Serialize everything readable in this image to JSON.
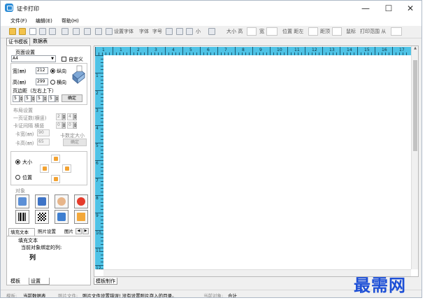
{
  "window": {
    "title": "证卡打印"
  },
  "menu": [
    "文件(F)",
    "编辑(E)",
    "帮助(H)"
  ],
  "toolbar": {
    "set_font": "设置字体",
    "font": "字体",
    "font_size": "字号",
    "size_small": "小",
    "size_label": "大小 高",
    "width_label": "宽",
    "position_label": "位置 距左",
    "top_label": "距顶",
    "border_label": "鼠标",
    "print_range": "打印范围 从"
  },
  "top_tabs": [
    "证书模板",
    "数据表"
  ],
  "page_settings": {
    "title": "页面设置",
    "paper": "A4",
    "custom": "自定义",
    "width_label": "宽(㎜)",
    "width_value": "212",
    "height_label": "高(㎜)",
    "height_value": "299",
    "portrait": "纵向",
    "landscape": "横向",
    "margin_label": "页边距（左右上下）",
    "margins": [
      "5",
      "5",
      "5",
      "5"
    ],
    "ok": "确定"
  },
  "layout_settings": {
    "title": "布局设置",
    "per_page": "一页证数(横竖)",
    "per_page_values": [
      "2",
      "4"
    ],
    "gap": "卡证间隔 横竖",
    "gap_values": [
      "0",
      "0"
    ],
    "card_width": "卡宽(㎜)",
    "card_width_value": "90",
    "card_height": "卡高(㎜)",
    "card_height_value": "65",
    "fixed_size": "卡数定大小",
    "ok": "确定"
  },
  "move_panel": {
    "size": "大小",
    "position": "位置"
  },
  "objects": {
    "title": "对象"
  },
  "sub_tabs": [
    "填充文本",
    "照片设置",
    "图片"
  ],
  "fill_text": {
    "title": "填充文本",
    "bound_column_label": "当前对象绑定的列:",
    "column": "列"
  },
  "bottom_tabs_left": [
    "模板",
    "设置"
  ],
  "bottom_tabs_right": [
    "模板制作"
  ],
  "ruler": {
    "h_labels": [
      "1",
      "1",
      "2",
      "3",
      "4",
      "5",
      "6",
      "7",
      "8",
      "9",
      "10",
      "11",
      "12",
      "13",
      "14",
      "15",
      "16",
      "17"
    ],
    "v_labels": [
      "1",
      "2",
      "3",
      "4",
      "5",
      "6",
      "7",
      "8",
      "9",
      "10",
      "11",
      "12"
    ]
  },
  "status": {
    "template_label": "模板:",
    "template_value": "当前数据表",
    "photo_label": "照片文件:",
    "photo_value": "照片文件设置错误! 没有设置照片存入的目录。",
    "current_label": "当前对象:",
    "current_value": "合计"
  },
  "watermark": "最需网",
  "colors": {
    "ruler": "#4fc3e6",
    "watermark": "#1d4fd6",
    "arrows": "#f2a232"
  }
}
